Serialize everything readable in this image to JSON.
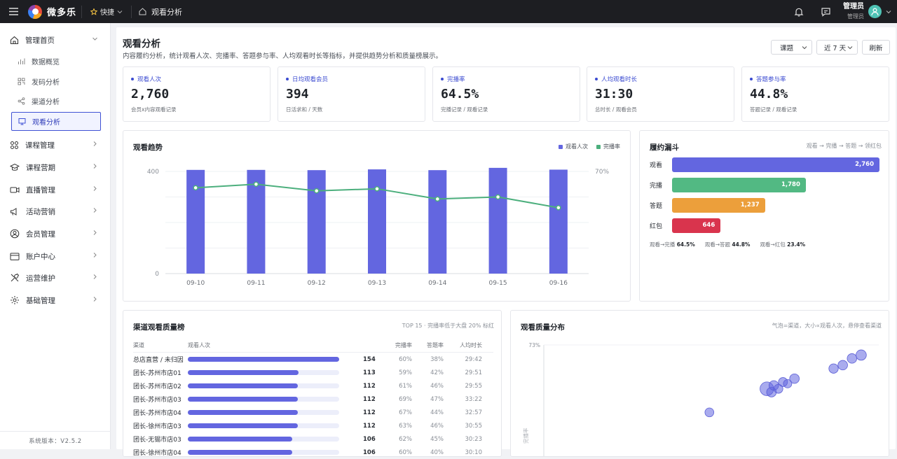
{
  "topbar": {
    "brand": "微多乐",
    "favorites_label": "快捷",
    "breadcrumb": "观看分析",
    "user_name": "管理员",
    "user_role": "管理员"
  },
  "sidebar": {
    "items": [
      {
        "label": "管理首页",
        "icon": "home-icon",
        "expanded": true
      },
      {
        "label": "课程管理",
        "icon": "grid-icon"
      },
      {
        "label": "课程营期",
        "icon": "cap-icon"
      },
      {
        "label": "直播管理",
        "icon": "video-icon"
      },
      {
        "label": "活动营销",
        "icon": "megaphone-icon"
      },
      {
        "label": "会员管理",
        "icon": "user-circle-icon"
      },
      {
        "label": "账户中心",
        "icon": "wallet-icon"
      },
      {
        "label": "运营维护",
        "icon": "tools-icon"
      },
      {
        "label": "基础管理",
        "icon": "gear-icon"
      }
    ],
    "sub_items": [
      {
        "label": "数据概览",
        "icon": "bar-chart-icon"
      },
      {
        "label": "发码分析",
        "icon": "qrcode-icon"
      },
      {
        "label": "渠道分析",
        "icon": "share-icon"
      },
      {
        "label": "观看分析",
        "icon": "monitor-icon",
        "active": true
      }
    ],
    "version": "系统版本：V2.5.2"
  },
  "page": {
    "title": "观看分析",
    "description": "内容履约分析，统计观看人次、完播率、答题参与率、人均观看时长等指标，并提供趋势分析和质量榜展示。",
    "filter_type": "课题",
    "filter_range": "近 7 天",
    "refresh_label": "刷新"
  },
  "kpis": [
    {
      "label": "观看人次",
      "value": "2,760",
      "sub": "会员x内容观看记录"
    },
    {
      "label": "日均观看会员",
      "value": "394",
      "sub": "日活求和 / 天数"
    },
    {
      "label": "完播率",
      "value": "64.5%",
      "sub": "完播记录 / 观看记录"
    },
    {
      "label": "人均观看时长",
      "value": "31:30",
      "sub": "总时长 / 观看会员"
    },
    {
      "label": "答题参与率",
      "value": "44.8%",
      "sub": "答题记录 / 观看记录"
    }
  ],
  "trend": {
    "title": "观看趋势",
    "legend_views": "观看人次",
    "legend_rate": "完播率",
    "y_left_ticks": [
      "400",
      "0"
    ],
    "y_right_tick": "70%"
  },
  "chart_data": {
    "type": "bar",
    "categories": [
      "09-10",
      "09-11",
      "09-12",
      "09-13",
      "09-14",
      "09-15",
      "09-16"
    ],
    "series": [
      {
        "name": "观看人次",
        "type": "bar",
        "values": [
          406,
          406,
          405,
          408,
          405,
          414,
          407
        ]
      },
      {
        "name": "完播率",
        "type": "line",
        "values": [
          66.8,
          67.5,
          66.2,
          66.6,
          64.6,
          65.0,
          62.9
        ]
      }
    ],
    "ylim": [
      0,
      400
    ],
    "y2_tick": "70%",
    "colors": {
      "bar": "#6366e0",
      "line": "#4caf7d"
    }
  },
  "funnel": {
    "title": "履约漏斗",
    "note": "观看 → 完播 → 答题 → 领红包",
    "stages": [
      {
        "label": "观看",
        "value": 2760,
        "display": "2,760",
        "color": "#6366e0"
      },
      {
        "label": "完播",
        "value": 1780,
        "display": "1,780",
        "color": "#52b983"
      },
      {
        "label": "答题",
        "value": 1237,
        "display": "1,237",
        "color": "#ec9f3b"
      },
      {
        "label": "红包",
        "value": 646,
        "display": "646",
        "color": "#d9344d"
      }
    ],
    "stats": [
      {
        "label": "观看→完播",
        "value": "64.5%"
      },
      {
        "label": "观看→答题",
        "value": "44.8%"
      },
      {
        "label": "观看→红包",
        "value": "23.4%"
      }
    ]
  },
  "rank": {
    "title": "渠道观看质量榜",
    "note": "TOP 15 · 完播率低于大盘 20% 标红",
    "headers": [
      "渠道",
      "观看人次",
      "完播率",
      "答题率",
      "人均时长"
    ],
    "max": 154,
    "rows": [
      {
        "name": "总店直营 / 未归因",
        "views": 154,
        "complete": "60%",
        "answer": "38%",
        "duration": "29:42"
      },
      {
        "name": "团长-苏州市店01",
        "views": 113,
        "complete": "59%",
        "answer": "42%",
        "duration": "29:51"
      },
      {
        "name": "团长-苏州市店02",
        "views": 112,
        "complete": "61%",
        "answer": "46%",
        "duration": "29:55"
      },
      {
        "name": "团长-苏州市店03",
        "views": 112,
        "complete": "69%",
        "answer": "47%",
        "duration": "33:22"
      },
      {
        "name": "团长-苏州市店04",
        "views": 112,
        "complete": "67%",
        "answer": "44%",
        "duration": "32:57"
      },
      {
        "name": "团长-徐州市店03",
        "views": 112,
        "complete": "63%",
        "answer": "46%",
        "duration": "30:55"
      },
      {
        "name": "团长-无锡市店03",
        "views": 106,
        "complete": "62%",
        "answer": "45%",
        "duration": "30:23"
      },
      {
        "name": "团长-徐州市店04",
        "views": 106,
        "complete": "60%",
        "answer": "40%",
        "duration": "30:10"
      }
    ]
  },
  "quality": {
    "title": "观看质量分布",
    "note": "气泡=渠道，大小∝观看人次，悬停查看渠道",
    "y_tick": "73%",
    "y_label": "完播率",
    "bubbles": [
      {
        "x": 29.7,
        "y": 60,
        "r": 154
      },
      {
        "x": 29.9,
        "y": 59,
        "r": 113
      },
      {
        "x": 30.0,
        "y": 61,
        "r": 112
      },
      {
        "x": 33.4,
        "y": 69,
        "r": 112
      },
      {
        "x": 33.0,
        "y": 67,
        "r": 112
      },
      {
        "x": 30.9,
        "y": 63,
        "r": 112
      },
      {
        "x": 30.4,
        "y": 62,
        "r": 106
      },
      {
        "x": 30.2,
        "y": 60,
        "r": 106
      },
      {
        "x": 33.8,
        "y": 70,
        "r": 120
      },
      {
        "x": 32.6,
        "y": 66,
        "r": 110
      },
      {
        "x": 30.6,
        "y": 61.5,
        "r": 100
      },
      {
        "x": 27.2,
        "y": 53,
        "r": 105
      }
    ]
  }
}
